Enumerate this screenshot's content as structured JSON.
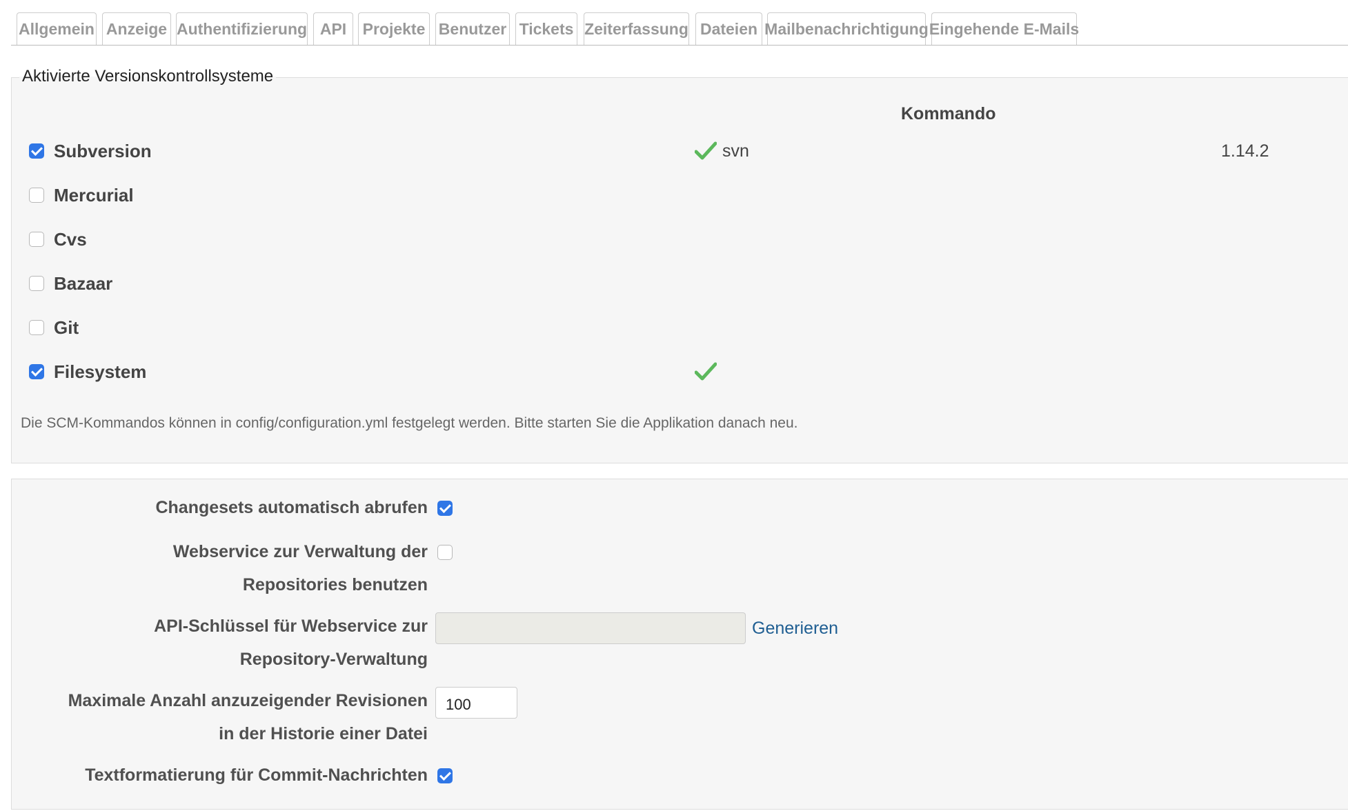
{
  "tabs": [
    {
      "label": "Allgemein"
    },
    {
      "label": "Anzeige"
    },
    {
      "label": "Authentifizierung"
    },
    {
      "label": "API"
    },
    {
      "label": "Projekte"
    },
    {
      "label": "Benutzer"
    },
    {
      "label": "Tickets"
    },
    {
      "label": "Zeiterfassung"
    },
    {
      "label": "Dateien"
    },
    {
      "label": "Mailbenachrichtigung"
    },
    {
      "label": "Eingehende E-Mails"
    }
  ],
  "scm": {
    "legend": "Aktivierte Versionskontrollsysteme",
    "column_header": "Kommando",
    "rows": [
      {
        "name": "Subversion",
        "enabled": true,
        "command_ok": true,
        "command": "svn",
        "version": "1.14.2"
      },
      {
        "name": "Mercurial",
        "enabled": false,
        "command_ok": false,
        "command": "",
        "version": ""
      },
      {
        "name": "Cvs",
        "enabled": false,
        "command_ok": false,
        "command": "",
        "version": ""
      },
      {
        "name": "Bazaar",
        "enabled": false,
        "command_ok": false,
        "command": "",
        "version": ""
      },
      {
        "name": "Git",
        "enabled": false,
        "command_ok": false,
        "command": "",
        "version": ""
      },
      {
        "name": "Filesystem",
        "enabled": true,
        "command_ok": true,
        "command": "",
        "version": ""
      }
    ],
    "hint": "Die SCM-Kommandos können in config/configuration.yml festgelegt werden. Bitte starten Sie die Applikation danach neu."
  },
  "settings": {
    "autofetch": {
      "label": "Changesets automatisch abrufen",
      "checked": true
    },
    "webservice": {
      "label_line1": "Webservice zur Verwaltung der",
      "label_line2": "Repositories benutzen",
      "checked": false
    },
    "api_key": {
      "label_line1": "API-Schlüssel für Webservice zur",
      "label_line2": "Repository-Verwaltung",
      "value": "",
      "generate_label": "Generieren"
    },
    "max_revisions": {
      "label_line1": "Maximale Anzahl anzuzeigender Revisionen",
      "label_line2": "in der Historie einer Datei",
      "value": "100"
    },
    "commit_formatting": {
      "label": "Textformatierung für Commit-Nachrichten",
      "checked": true
    }
  },
  "colors": {
    "checkbox_checked": "#2f76e6",
    "check_icon": "#5cb85c",
    "link": "#1f5e92"
  }
}
